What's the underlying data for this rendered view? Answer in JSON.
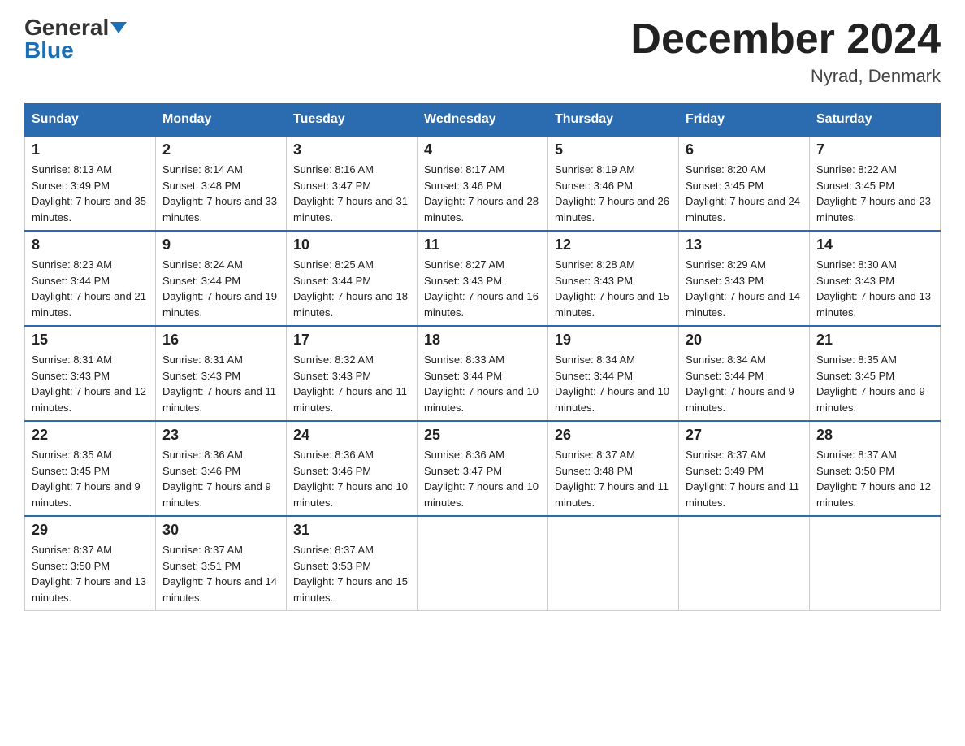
{
  "header": {
    "logo_general": "General",
    "logo_blue": "Blue",
    "month_title": "December 2024",
    "location": "Nyrad, Denmark"
  },
  "days_of_week": [
    "Sunday",
    "Monday",
    "Tuesday",
    "Wednesday",
    "Thursday",
    "Friday",
    "Saturday"
  ],
  "weeks": [
    [
      {
        "day": "1",
        "sunrise": "8:13 AM",
        "sunset": "3:49 PM",
        "daylight": "7 hours and 35 minutes."
      },
      {
        "day": "2",
        "sunrise": "8:14 AM",
        "sunset": "3:48 PM",
        "daylight": "7 hours and 33 minutes."
      },
      {
        "day": "3",
        "sunrise": "8:16 AM",
        "sunset": "3:47 PM",
        "daylight": "7 hours and 31 minutes."
      },
      {
        "day": "4",
        "sunrise": "8:17 AM",
        "sunset": "3:46 PM",
        "daylight": "7 hours and 28 minutes."
      },
      {
        "day": "5",
        "sunrise": "8:19 AM",
        "sunset": "3:46 PM",
        "daylight": "7 hours and 26 minutes."
      },
      {
        "day": "6",
        "sunrise": "8:20 AM",
        "sunset": "3:45 PM",
        "daylight": "7 hours and 24 minutes."
      },
      {
        "day": "7",
        "sunrise": "8:22 AM",
        "sunset": "3:45 PM",
        "daylight": "7 hours and 23 minutes."
      }
    ],
    [
      {
        "day": "8",
        "sunrise": "8:23 AM",
        "sunset": "3:44 PM",
        "daylight": "7 hours and 21 minutes."
      },
      {
        "day": "9",
        "sunrise": "8:24 AM",
        "sunset": "3:44 PM",
        "daylight": "7 hours and 19 minutes."
      },
      {
        "day": "10",
        "sunrise": "8:25 AM",
        "sunset": "3:44 PM",
        "daylight": "7 hours and 18 minutes."
      },
      {
        "day": "11",
        "sunrise": "8:27 AM",
        "sunset": "3:43 PM",
        "daylight": "7 hours and 16 minutes."
      },
      {
        "day": "12",
        "sunrise": "8:28 AM",
        "sunset": "3:43 PM",
        "daylight": "7 hours and 15 minutes."
      },
      {
        "day": "13",
        "sunrise": "8:29 AM",
        "sunset": "3:43 PM",
        "daylight": "7 hours and 14 minutes."
      },
      {
        "day": "14",
        "sunrise": "8:30 AM",
        "sunset": "3:43 PM",
        "daylight": "7 hours and 13 minutes."
      }
    ],
    [
      {
        "day": "15",
        "sunrise": "8:31 AM",
        "sunset": "3:43 PM",
        "daylight": "7 hours and 12 minutes."
      },
      {
        "day": "16",
        "sunrise": "8:31 AM",
        "sunset": "3:43 PM",
        "daylight": "7 hours and 11 minutes."
      },
      {
        "day": "17",
        "sunrise": "8:32 AM",
        "sunset": "3:43 PM",
        "daylight": "7 hours and 11 minutes."
      },
      {
        "day": "18",
        "sunrise": "8:33 AM",
        "sunset": "3:44 PM",
        "daylight": "7 hours and 10 minutes."
      },
      {
        "day": "19",
        "sunrise": "8:34 AM",
        "sunset": "3:44 PM",
        "daylight": "7 hours and 10 minutes."
      },
      {
        "day": "20",
        "sunrise": "8:34 AM",
        "sunset": "3:44 PM",
        "daylight": "7 hours and 9 minutes."
      },
      {
        "day": "21",
        "sunrise": "8:35 AM",
        "sunset": "3:45 PM",
        "daylight": "7 hours and 9 minutes."
      }
    ],
    [
      {
        "day": "22",
        "sunrise": "8:35 AM",
        "sunset": "3:45 PM",
        "daylight": "7 hours and 9 minutes."
      },
      {
        "day": "23",
        "sunrise": "8:36 AM",
        "sunset": "3:46 PM",
        "daylight": "7 hours and 9 minutes."
      },
      {
        "day": "24",
        "sunrise": "8:36 AM",
        "sunset": "3:46 PM",
        "daylight": "7 hours and 10 minutes."
      },
      {
        "day": "25",
        "sunrise": "8:36 AM",
        "sunset": "3:47 PM",
        "daylight": "7 hours and 10 minutes."
      },
      {
        "day": "26",
        "sunrise": "8:37 AM",
        "sunset": "3:48 PM",
        "daylight": "7 hours and 11 minutes."
      },
      {
        "day": "27",
        "sunrise": "8:37 AM",
        "sunset": "3:49 PM",
        "daylight": "7 hours and 11 minutes."
      },
      {
        "day": "28",
        "sunrise": "8:37 AM",
        "sunset": "3:50 PM",
        "daylight": "7 hours and 12 minutes."
      }
    ],
    [
      {
        "day": "29",
        "sunrise": "8:37 AM",
        "sunset": "3:50 PM",
        "daylight": "7 hours and 13 minutes."
      },
      {
        "day": "30",
        "sunrise": "8:37 AM",
        "sunset": "3:51 PM",
        "daylight": "7 hours and 14 minutes."
      },
      {
        "day": "31",
        "sunrise": "8:37 AM",
        "sunset": "3:53 PM",
        "daylight": "7 hours and 15 minutes."
      },
      null,
      null,
      null,
      null
    ]
  ]
}
